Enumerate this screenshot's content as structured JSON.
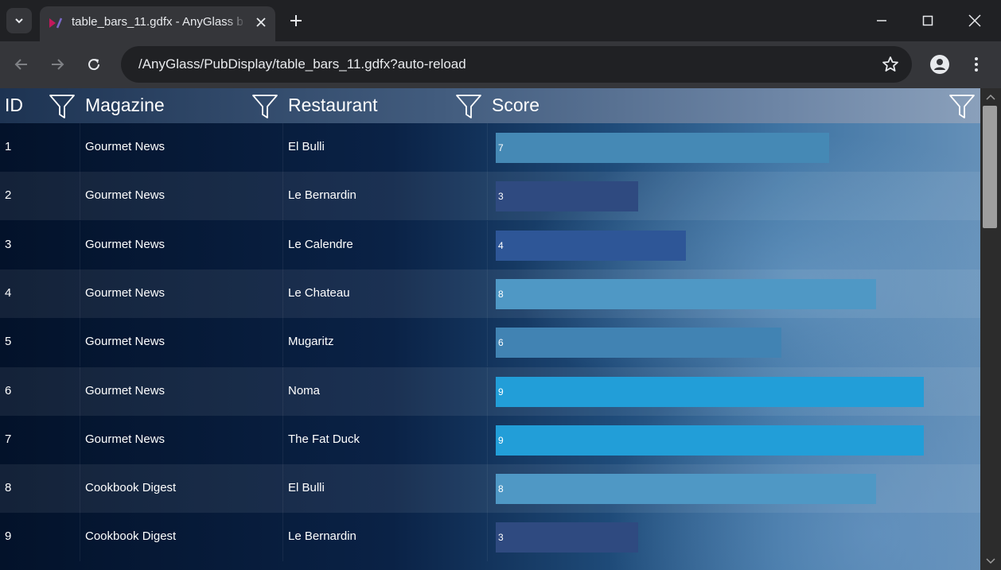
{
  "browser": {
    "tab_title": "table_bars_11.gdfx - AnyGlass b",
    "url": "/AnyGlass/PubDisplay/table_bars_11.gdfx?auto-reload"
  },
  "table": {
    "columns": [
      "ID",
      "Magazine",
      "Restaurant",
      "Score"
    ],
    "score_max": 10,
    "rows": [
      {
        "id": "1",
        "magazine": "Gourmet News",
        "restaurant": "El Bulli",
        "score": 7,
        "score_label": "7",
        "color": "#4589b5"
      },
      {
        "id": "2",
        "magazine": "Gourmet News",
        "restaurant": "Le Bernardin",
        "score": 3,
        "score_label": "3",
        "color": "#2f4a80"
      },
      {
        "id": "3",
        "magazine": "Gourmet News",
        "restaurant": "Le Calendre",
        "score": 4,
        "score_label": "4",
        "color": "#2e5697"
      },
      {
        "id": "4",
        "magazine": "Gourmet News",
        "restaurant": "Le Chateau",
        "score": 8,
        "score_label": "8",
        "color": "#4f98c5"
      },
      {
        "id": "5",
        "magazine": "Gourmet News",
        "restaurant": "Mugaritz",
        "score": 6,
        "score_label": "6",
        "color": "#4183b3"
      },
      {
        "id": "6",
        "magazine": "Gourmet News",
        "restaurant": "Noma",
        "score": 9,
        "score_label": "9",
        "color": "#229ed8"
      },
      {
        "id": "7",
        "magazine": "Gourmet News",
        "restaurant": "The Fat Duck",
        "score": 9,
        "score_label": "9",
        "color": "#229ed8"
      },
      {
        "id": "8",
        "magazine": "Cookbook Digest",
        "restaurant": "El Bulli",
        "score": 8,
        "score_label": "8",
        "color": "#4f98c5"
      },
      {
        "id": "9",
        "magazine": "Cookbook Digest",
        "restaurant": "Le Bernardin",
        "score": 3,
        "score_label": "3",
        "color": "#2f4a80"
      }
    ]
  }
}
